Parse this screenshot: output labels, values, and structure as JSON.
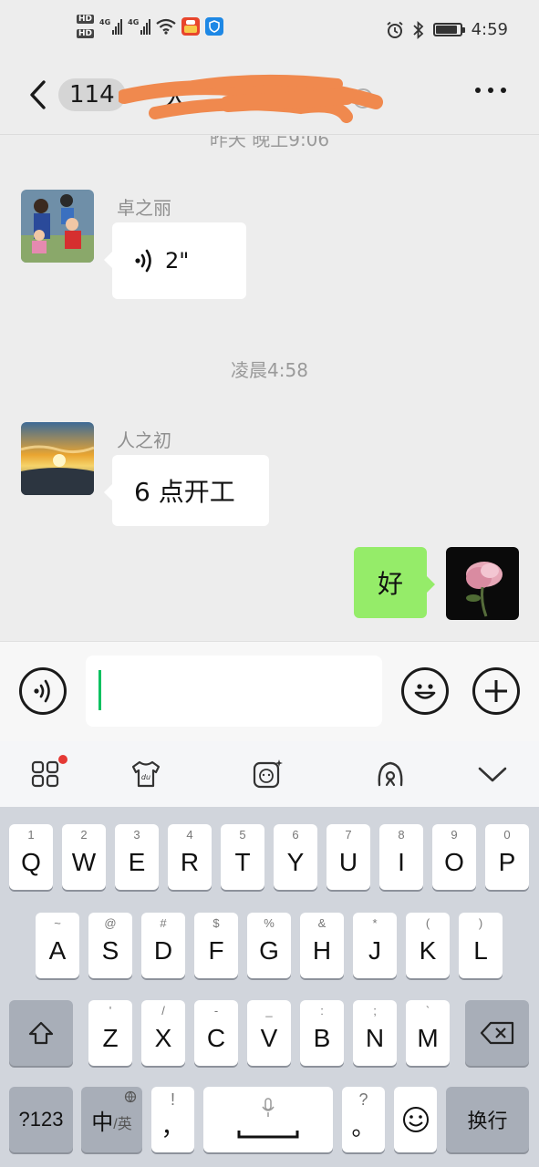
{
  "status_bar": {
    "hd1": "HD",
    "hd2": "HD",
    "signal1": "4G",
    "signal2": "4G",
    "time": "4:59",
    "battery_level": 0.9,
    "icons": [
      "alarm-icon",
      "bluetooth-icon",
      "battery-icon"
    ]
  },
  "header": {
    "unread_count": "114",
    "title_redacted": true
  },
  "chat": {
    "partial_timestamp": "昨天 晚上9:06",
    "timestamp2": "凌晨4:58",
    "messages": [
      {
        "sender": "卓之丽",
        "type": "voice",
        "duration": "2\""
      },
      {
        "sender": "人之初",
        "type": "text",
        "text": "6 点开工"
      },
      {
        "sender": "me",
        "type": "text",
        "text": "好"
      }
    ]
  },
  "input": {
    "value": ""
  },
  "keyboard": {
    "row1": [
      {
        "k": "Q",
        "s": "1"
      },
      {
        "k": "W",
        "s": "2"
      },
      {
        "k": "E",
        "s": "3"
      },
      {
        "k": "R",
        "s": "4"
      },
      {
        "k": "T",
        "s": "5"
      },
      {
        "k": "Y",
        "s": "6"
      },
      {
        "k": "U",
        "s": "7"
      },
      {
        "k": "I",
        "s": "8"
      },
      {
        "k": "O",
        "s": "9"
      },
      {
        "k": "P",
        "s": "0"
      }
    ],
    "row2": [
      {
        "k": "A",
        "s": "~"
      },
      {
        "k": "S",
        "s": "@"
      },
      {
        "k": "D",
        "s": "#"
      },
      {
        "k": "F",
        "s": "$"
      },
      {
        "k": "G",
        "s": "%"
      },
      {
        "k": "H",
        "s": "&"
      },
      {
        "k": "J",
        "s": "*"
      },
      {
        "k": "K",
        "s": "("
      },
      {
        "k": "L",
        "s": ")"
      }
    ],
    "row3": [
      {
        "k": "Z",
        "s": "'"
      },
      {
        "k": "X",
        "s": "/"
      },
      {
        "k": "C",
        "s": "-"
      },
      {
        "k": "V",
        "s": "_"
      },
      {
        "k": "B",
        "s": ":"
      },
      {
        "k": "N",
        "s": ";"
      },
      {
        "k": "M",
        "s": "`"
      }
    ],
    "sym_key": "?123",
    "lang_main": "中",
    "lang_sub": "/英",
    "comma_sup": "!",
    "comma": "，",
    "period_sup": "?",
    "period": "。",
    "enter_label": "换行"
  },
  "colors": {
    "accent": "#07c160",
    "my_bubble": "#95ec69",
    "redaction": "#f0894e"
  }
}
